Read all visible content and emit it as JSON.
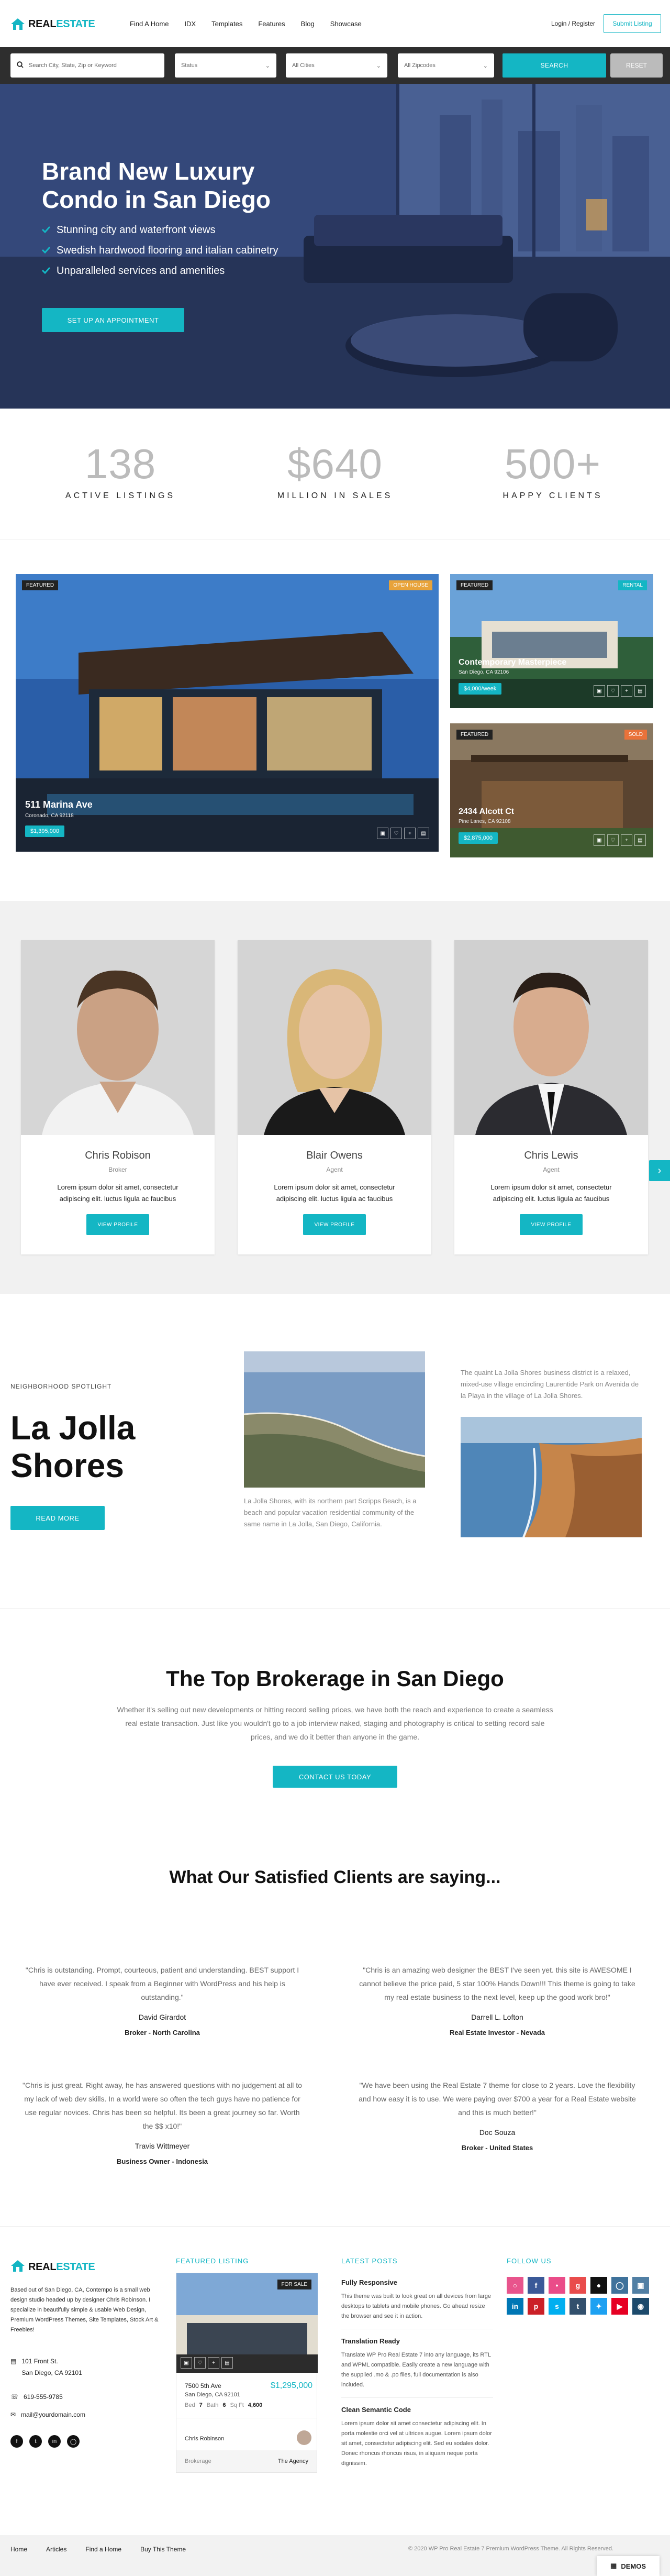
{
  "header": {
    "logo_word1": "REAL",
    "logo_word2": "ESTATE",
    "nav": [
      "Find A Home",
      "IDX",
      "Templates",
      "Features",
      "Blog",
      "Showcase"
    ],
    "login": "Login / Register",
    "submit": "Submit Listing"
  },
  "search": {
    "placeholder": "Search City, State, Zip or Keyword",
    "status": "Status",
    "cities": "All Cities",
    "zipcodes": "All Zipcodes",
    "search_button": "SEARCH",
    "reset_button": "RESET"
  },
  "hero": {
    "title_line1": "Brand New Luxury",
    "title_line2": "Condo in San Diego",
    "bullets": [
      "Stunning city and waterfront views",
      "Swedish hardwood flooring and italian cabinetry",
      "Unparalleled services and amenities"
    ],
    "button": "SET UP AN APPOINTMENT"
  },
  "stats": [
    {
      "number": "138",
      "label": "ACTIVE LISTINGS"
    },
    {
      "number": "$640",
      "label": "MILLION IN SALES"
    },
    {
      "number": "500+",
      "label": "HAPPY CLIENTS"
    }
  ],
  "listings": [
    {
      "badge": "FEATURED",
      "status": "OPEN HOUSE",
      "title": "511 Marina Ave",
      "sub": "Coronado, CA 92118",
      "price": "$1,395,000"
    },
    {
      "badge": "FEATURED",
      "status": "RENTAL",
      "title": "Contemporary Masterpiece",
      "sub": "San Diego, CA 92106",
      "price": "$4,000/week"
    },
    {
      "badge": "FEATURED",
      "status": "SOLD",
      "title": "2434 Alcott Ct",
      "sub": "Pine Lanes, CA 92108",
      "price": "$2,875,000"
    }
  ],
  "agents": [
    {
      "name": "Chris Robison",
      "role": "Broker",
      "desc": "Lorem ipsum dolor sit amet, consectetur adipiscing elit. luctus ligula ac faucibus",
      "button": "VIEW PROFILE"
    },
    {
      "name": "Blair Owens",
      "role": "Agent",
      "desc": "Lorem ipsum dolor sit amet, consectetur adipiscing elit. luctus ligula ac faucibus",
      "button": "VIEW PROFILE"
    },
    {
      "name": "Chris Lewis",
      "role": "Agent",
      "desc": "Lorem ipsum dolor sit amet, consectetur adipiscing elit. luctus ligula ac faucibus",
      "button": "VIEW PROFILE"
    }
  ],
  "neighborhood": {
    "small": "NEIGHBORHOOD SPOTLIGHT",
    "title_line1": "La Jolla",
    "title_line2": "Shores",
    "button": "READ MORE",
    "text_mid": "La Jolla Shores, with its northern part Scripps Beach, is a beach and popular vacation residential community of the same name in La Jolla, San Diego, California.",
    "text_right": "The quaint La Jolla Shores business district is a relaxed, mixed-use village encircling Laurentide Park on Avenida de la Playa in the village of La Jolla Shores."
  },
  "brokerage": {
    "title": "The Top Brokerage in San Diego",
    "text": "Whether it's selling out new developments or hitting record selling prices, we have both the reach and experience to create a seamless real estate transaction. Just like you wouldn't go to a job interview naked, staging and photography is critical to setting record sale prices, and we do it better than anyone in the game.",
    "button": "CONTACT US TODAY"
  },
  "testimonials": {
    "title": "What Our Satisfied Clients are saying...",
    "items": [
      {
        "quote": "\"Chris is outstanding. Prompt, courteous, patient and understanding. BEST support I have ever received. I speak from a Beginner with WordPress and his help is outstanding.\"",
        "name": "David Girardot",
        "role": "Broker - North Carolina"
      },
      {
        "quote": "\"Chris is an amazing web designer the BEST I've seen yet. this site is AWESOME I cannot believe the price paid, 5 star 100% Hands Down!!! This theme is going to take my real estate business to the next level, keep up the good work bro!\"",
        "name": "Darrell L. Lofton",
        "role": "Real Estate Investor - Nevada"
      },
      {
        "quote": "\"Chris is just great. Right away, he has answered questions with no judgement at all to my lack of web dev skills. In a world were so often the tech guys have no patience for use regular novices. Chris has been so helpful. Its been a great journey so far. Worth the $$ x10!\"",
        "name": "Travis Wittmeyer",
        "role": "Business Owner - Indonesia"
      },
      {
        "quote": "\"We have been using the Real Estate 7 theme for close to 2 years. Love the flexibility and how easy it is to use. We were paying over $700 a year for a Real Estate website and this is much better!\"",
        "name": "Doc Souza",
        "role": "Broker - United States"
      }
    ]
  },
  "footer": {
    "about": "Based out of San Diego, CA, Contempo is a small web design studio headed up by designer Chris Robinson. I specialize in beautifully simple & usable Web Design, Premium WordPress Themes, Site Templates, Stock Art & Freebies!",
    "address1": "101 Front St.",
    "address2": "San Diego, CA 92101",
    "phone": "619-555-9785",
    "email": "mail@yourdomain.com",
    "featured_head": "FEATURED LISTING",
    "featured": {
      "badge": "FOR SALE",
      "address1": "7500 5th Ave",
      "address2": "San Diego, CA 92101",
      "price": "$1,295,000",
      "bed_label": "Bed",
      "bed": "7",
      "bath_label": "Bath",
      "bath": "6",
      "sqft_label": "Sq Ft",
      "sqft": "4,600",
      "agent": "Chris Robinson",
      "brokerage_label": "Brokerage",
      "brokerage": "The Agency"
    },
    "posts_head": "LATEST POSTS",
    "posts": [
      {
        "title": "Fully Responsive",
        "text": "This theme was built to look great on all devices from large desktops to tablets and mobile phones. Go ahead resize the browser and see it in action."
      },
      {
        "title": "Translation Ready",
        "text": "Translate WP Pro Real Estate 7 into any language, its RTL and WPML compatible. Easily create a new language with the supplied .mo & .po files, full documentation is also included."
      },
      {
        "title": "Clean Semantic Code",
        "text": "Lorem ipsum dolor sit amet consectetur adipiscing elit. In porta molestie orci vel at ultrices augue. Lorem ipsum dolor sit amet, consectetur adipiscing elit. Sed eu sodales dolor. Donec rhoncus rhoncus risus, in aliquam neque porta dignissim."
      }
    ],
    "follow_head": "FOLLOW US"
  },
  "bottom": {
    "links": [
      "Home",
      "Articles",
      "Find a Home",
      "Buy This Theme"
    ],
    "copyright": "© 2020 WP Pro Real Estate 7 Premium WordPress Theme. All Rights Reserved.",
    "demos": "DEMOS"
  },
  "colors": {
    "accent": "#14b6c4",
    "dark": "#2e2e2e"
  }
}
